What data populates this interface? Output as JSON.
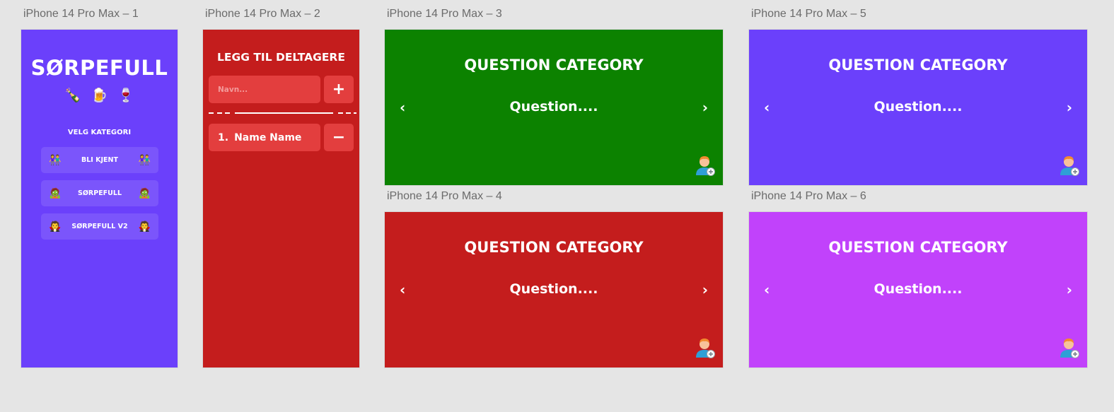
{
  "artboards": {
    "ab1": {
      "label": "iPhone 14 Pro Max – 1"
    },
    "ab2": {
      "label": "iPhone 14 Pro Max – 2"
    },
    "ab3": {
      "label": "iPhone 14 Pro Max – 3"
    },
    "ab4": {
      "label": "iPhone 14 Pro Max – 4"
    },
    "ab5": {
      "label": "iPhone 14 Pro Max – 5"
    },
    "ab6": {
      "label": "iPhone 14 Pro Max – 6"
    }
  },
  "home": {
    "logo": "SØRPEFULL",
    "emojis": [
      "🍾",
      "🍺",
      "🍷"
    ],
    "category_heading": "VELG KATEGORI",
    "categories": [
      {
        "label": "BLI KJENT",
        "icon": "👫"
      },
      {
        "label": "SØRPEFULL",
        "icon": "🧟"
      },
      {
        "label": "SØRPEFULL V2",
        "icon": "🧛"
      }
    ],
    "bg_color": "#6b40fb"
  },
  "participants": {
    "title": "LEGG TIL DELTAGERE",
    "name_placeholder": "Navn...",
    "add_symbol": "+",
    "remove_symbol": "−",
    "list": [
      {
        "number": "1.",
        "name": "Name Name"
      }
    ],
    "bg_color": "#c41d1d"
  },
  "question_screens": [
    {
      "category": "QUESTION CATEGORY",
      "question": "Question....",
      "prev": "‹",
      "next": "›",
      "bg_color": "#0c8200"
    },
    {
      "category": "QUESTION CATEGORY",
      "question": "Question....",
      "prev": "‹",
      "next": "›",
      "bg_color": "#c41d1d"
    },
    {
      "category": "QUESTION CATEGORY",
      "question": "Question....",
      "prev": "‹",
      "next": "›",
      "bg_color": "#6b40fb"
    },
    {
      "category": "QUESTION CATEGORY",
      "question": "Question....",
      "prev": "‹",
      "next": "›",
      "bg_color": "#c142fb"
    }
  ],
  "icons": {
    "add_player": "add-user-icon"
  }
}
